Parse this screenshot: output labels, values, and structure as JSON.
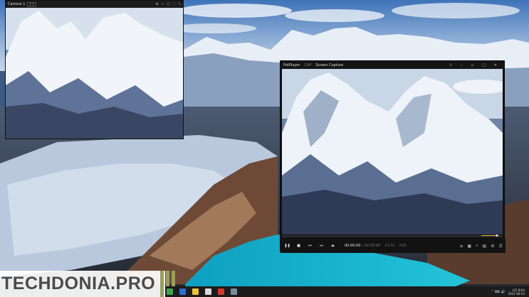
{
  "camera_window": {
    "title": "Camera 1",
    "tag": "1:1"
  },
  "potplayer": {
    "app_name": "PotPlayer",
    "menu_items": [
      "CAP",
      "Screen Capture"
    ],
    "time_current": "00:00:00",
    "time_total": "/ 00:00:00",
    "time_extra": "19:32",
    "codec_badge": "H26"
  },
  "watermark": {
    "text": "TECHDONIA.PRO"
  },
  "taskbar": {
    "clock_time": "오후 8:04",
    "clock_date": "2021-06-23"
  },
  "colors": {
    "accent_yellow": "#e2c13c",
    "lake": "#17b6cf",
    "brand_stripe": "#9a9e60"
  }
}
